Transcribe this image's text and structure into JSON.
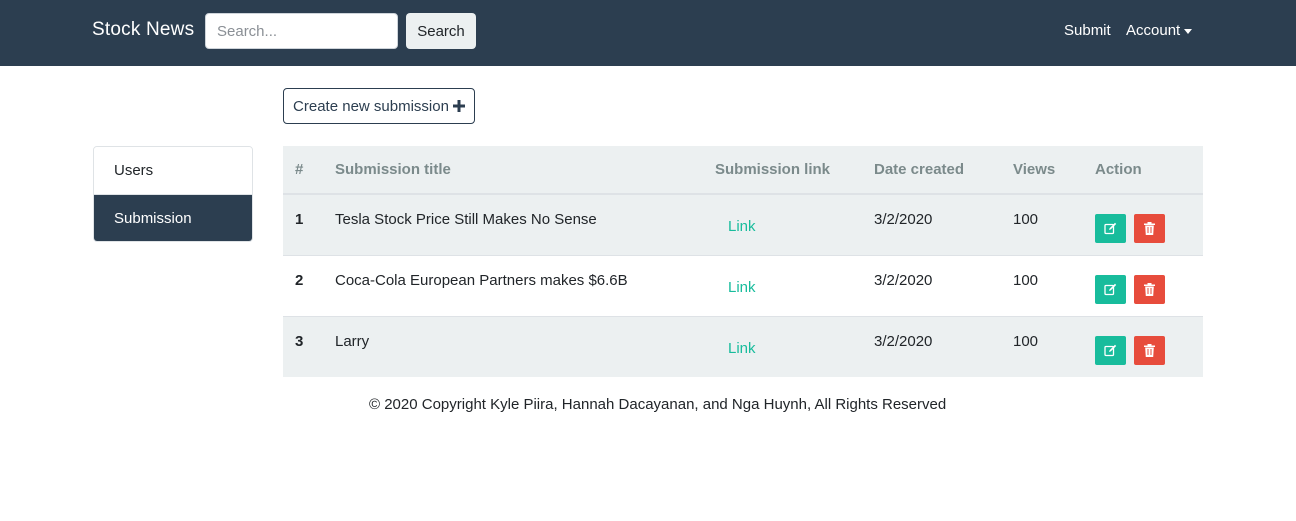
{
  "navbar": {
    "brand": "Stock News",
    "search_placeholder": "Search...",
    "search_button": "Search",
    "submit_link": "Submit",
    "account_menu": "Account"
  },
  "create_button": "Create new submission",
  "sidebar": {
    "items": [
      {
        "label": "Users",
        "active": false
      },
      {
        "label": "Submission",
        "active": true
      }
    ]
  },
  "table": {
    "headers": [
      "#",
      "Submission title",
      "Submission link",
      "Date created",
      "Views",
      "Action"
    ],
    "rows": [
      {
        "num": "1",
        "title": "Tesla Stock Price Still Makes No Sense",
        "link": "Link",
        "date": "3/2/2020",
        "views": "100"
      },
      {
        "num": "2",
        "title": "Coca-Cola European Partners makes $6.6B",
        "link": "Link",
        "date": "3/2/2020",
        "views": "100"
      },
      {
        "num": "3",
        "title": "Larry",
        "link": "Link",
        "date": "3/2/2020",
        "views": "100"
      }
    ]
  },
  "footer": "© 2020 Copyright Kyle Piira, Hannah Dacayanan, and Nga Huynh, All Rights Reserved",
  "colors": {
    "navbar": "#2c3e50",
    "accent": "#18bc9c",
    "danger": "#e74c3c",
    "table_stripe": "#ecf0f1"
  },
  "icons": {
    "create": "plus-icon",
    "edit": "edit-icon",
    "delete": "trash-icon",
    "account": "caret-down-icon"
  }
}
